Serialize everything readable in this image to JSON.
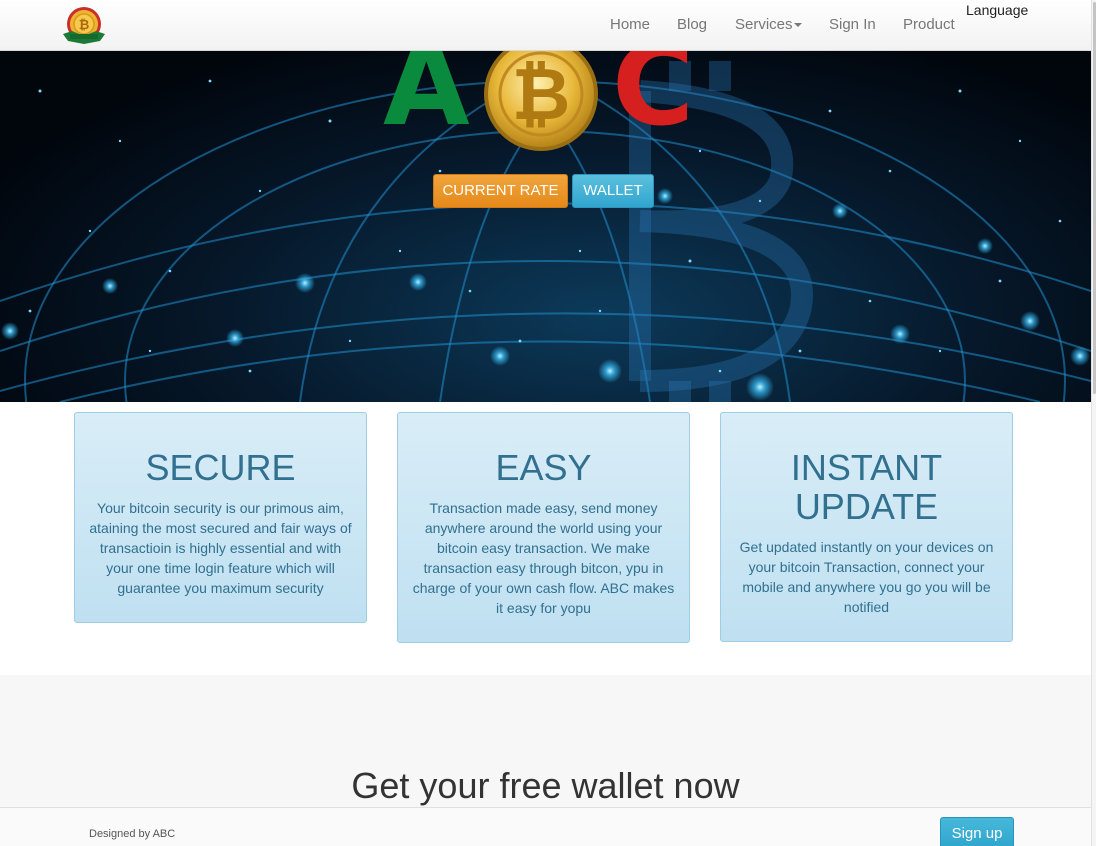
{
  "nav": {
    "items": [
      {
        "label": "Home"
      },
      {
        "label": "Blog"
      },
      {
        "label": "Services"
      },
      {
        "label": "Sign In"
      },
      {
        "label": "Product"
      }
    ],
    "language_label": "Language",
    "logo_icon": "bitcoin-badge-logo"
  },
  "hero": {
    "brand_letters": {
      "first": "A",
      "last": "C"
    },
    "coin_icon": "bitcoin-coin-icon",
    "buttons": {
      "current_rate": "CURRENT RATE",
      "wallet": "WALLET"
    }
  },
  "features": [
    {
      "title": "SECURE",
      "text": "Your bitcoin security is our primous aim, ataining the most secured and fair ways of transactioin is highly essential and with your one time login feature which will guarantee you maximum security"
    },
    {
      "title": "EASY",
      "text": "Transaction made easy, send money anywhere around the world using your bitcoin easy transaction. We make transaction easy through bitcon, ypu in charge of your own cash flow. ABC makes it easy for yopu"
    },
    {
      "title": "INSTANT UPDATE",
      "text": "Get updated instantly on your devices on your bitcoin Transaction, connect your mobile and anywhere you go you will be notified"
    }
  ],
  "wallet_section": {
    "title": "Get your free wallet now"
  },
  "footer": {
    "designed_by": "Designed by ABC",
    "signup_label": "Sign up"
  },
  "colors": {
    "letter_a": "#0a8a3c",
    "letter_c": "#d62020",
    "coin_gold": "#e8b83a",
    "rate_button": "#f0a53c",
    "wallet_button": "#5bc0de",
    "card_text": "#31708f"
  }
}
